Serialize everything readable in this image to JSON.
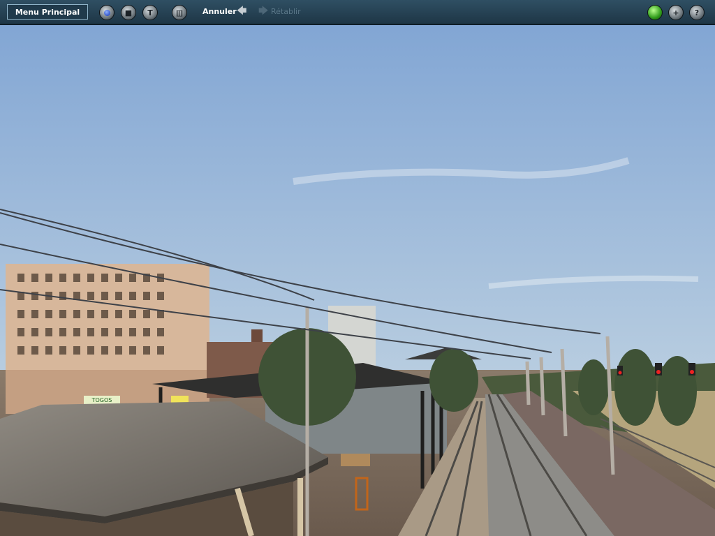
{
  "toolbar": {
    "menu_label": "Menu Principal",
    "undo_label": "Annuler",
    "redo_label": "Rétablir",
    "left_icons": [
      "record-icon",
      "stop-icon",
      "tools-icon",
      "trash-icon"
    ],
    "right_icons": [
      "status-light-icon",
      "add-icon",
      "help-icon"
    ]
  },
  "scene": {
    "description_icons": [
      "sky",
      "buildings",
      "power-lines",
      "station-shed",
      "platform",
      "railway-tracks",
      "signals",
      "trees"
    ],
    "shop_signs": [
      "TOGOS"
    ]
  },
  "colors": {
    "toolbar_bg": "#2f4f63",
    "sky_top": "#7ea3d3",
    "sky_bottom": "#c9d7e3",
    "status_green": "#2f9a1a"
  }
}
